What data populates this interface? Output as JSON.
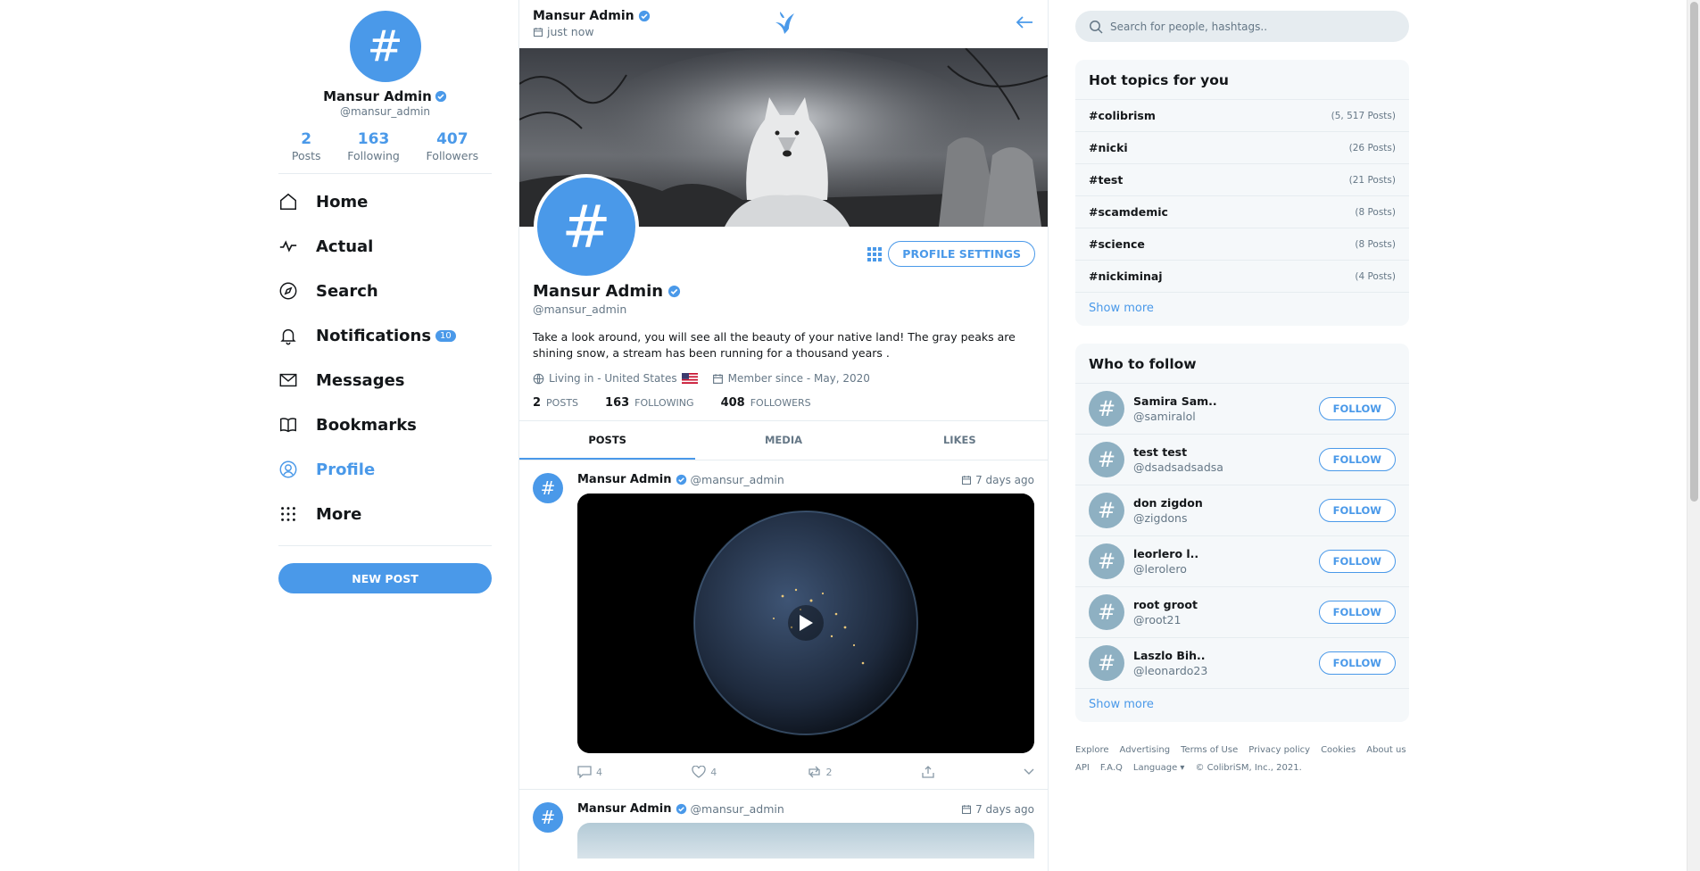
{
  "me": {
    "avatar_glyph": "#",
    "name": "Mansur Admin",
    "handle": "@mansur_admin",
    "stats": [
      {
        "num": "2",
        "label": "Posts"
      },
      {
        "num": "163",
        "label": "Following"
      },
      {
        "num": "407",
        "label": "Followers"
      }
    ]
  },
  "nav": [
    {
      "label": "Home",
      "icon": "home-icon"
    },
    {
      "label": "Actual",
      "icon": "activity-icon"
    },
    {
      "label": "Search",
      "icon": "compass-icon"
    },
    {
      "label": "Notifications",
      "icon": "bell-icon",
      "badge": "10"
    },
    {
      "label": "Messages",
      "icon": "mail-icon"
    },
    {
      "label": "Bookmarks",
      "icon": "book-icon"
    },
    {
      "label": "Profile",
      "icon": "user-circle-icon",
      "active": true
    },
    {
      "label": "More",
      "icon": "grid-dots-icon"
    }
  ],
  "new_post_label": "NEW POST",
  "topbar": {
    "name": "Mansur Admin",
    "time": "just now"
  },
  "profile": {
    "avatar_glyph": "#",
    "settings_label": "PROFILE SETTINGS",
    "name": "Mansur Admin",
    "handle": "@mansur_admin",
    "bio": "Take a look around, you will see all the beauty of your native land! The gray peaks are shining snow, a stream has been running for a thousand years .",
    "location": "Living in - United States",
    "member_since": "Member since - May, 2020",
    "counts": [
      {
        "num": "2",
        "label": "POSTS"
      },
      {
        "num": "163",
        "label": "FOLLOWING"
      },
      {
        "num": "408",
        "label": "FOLLOWERS"
      }
    ]
  },
  "tabs": [
    "POSTS",
    "MEDIA",
    "LIKES"
  ],
  "posts": [
    {
      "avatar_glyph": "#",
      "name": "Mansur Admin",
      "handle": "@mansur_admin",
      "time": "7 days ago",
      "comments": "4",
      "likes": "4",
      "reposts": "2"
    },
    {
      "avatar_glyph": "#",
      "name": "Mansur Admin",
      "handle": "@mansur_admin",
      "time": "7 days ago"
    }
  ],
  "search": {
    "placeholder": "Search for people, hashtags.."
  },
  "hot_topics": {
    "title": "Hot topics for you",
    "items": [
      {
        "tag": "#colibrism",
        "count": "(5, 517 Posts)"
      },
      {
        "tag": "#nicki",
        "count": "(26 Posts)"
      },
      {
        "tag": "#test",
        "count": "(21 Posts)"
      },
      {
        "tag": "#scamdemic",
        "count": "(8 Posts)"
      },
      {
        "tag": "#science",
        "count": "(8 Posts)"
      },
      {
        "tag": "#nickiminaj",
        "count": "(4 Posts)"
      }
    ],
    "show_more": "Show more"
  },
  "who_to_follow": {
    "title": "Who to follow",
    "follow_label": "FOLLOW",
    "avatar_glyph": "#",
    "items": [
      {
        "name": "Samira Sam..",
        "handle": "@samiralol"
      },
      {
        "name": "test test",
        "handle": "@dsadsadsadsa"
      },
      {
        "name": "don zigdon",
        "handle": "@zigdons"
      },
      {
        "name": "leorlero l..",
        "handle": "@lerolero"
      },
      {
        "name": "root groot",
        "handle": "@root21"
      },
      {
        "name": "Laszlo Bih..",
        "handle": "@leonardo23"
      }
    ],
    "show_more": "Show more"
  },
  "footer": [
    "Explore",
    "Advertising",
    "Terms of Use",
    "Privacy policy",
    "Cookies",
    "About us",
    "API",
    "F.A.Q",
    "Language ▾",
    "© ColibriSM, Inc., 2021."
  ],
  "colors": {
    "accent": "#4a99e9",
    "text": "#14171a",
    "muted": "#657786"
  }
}
